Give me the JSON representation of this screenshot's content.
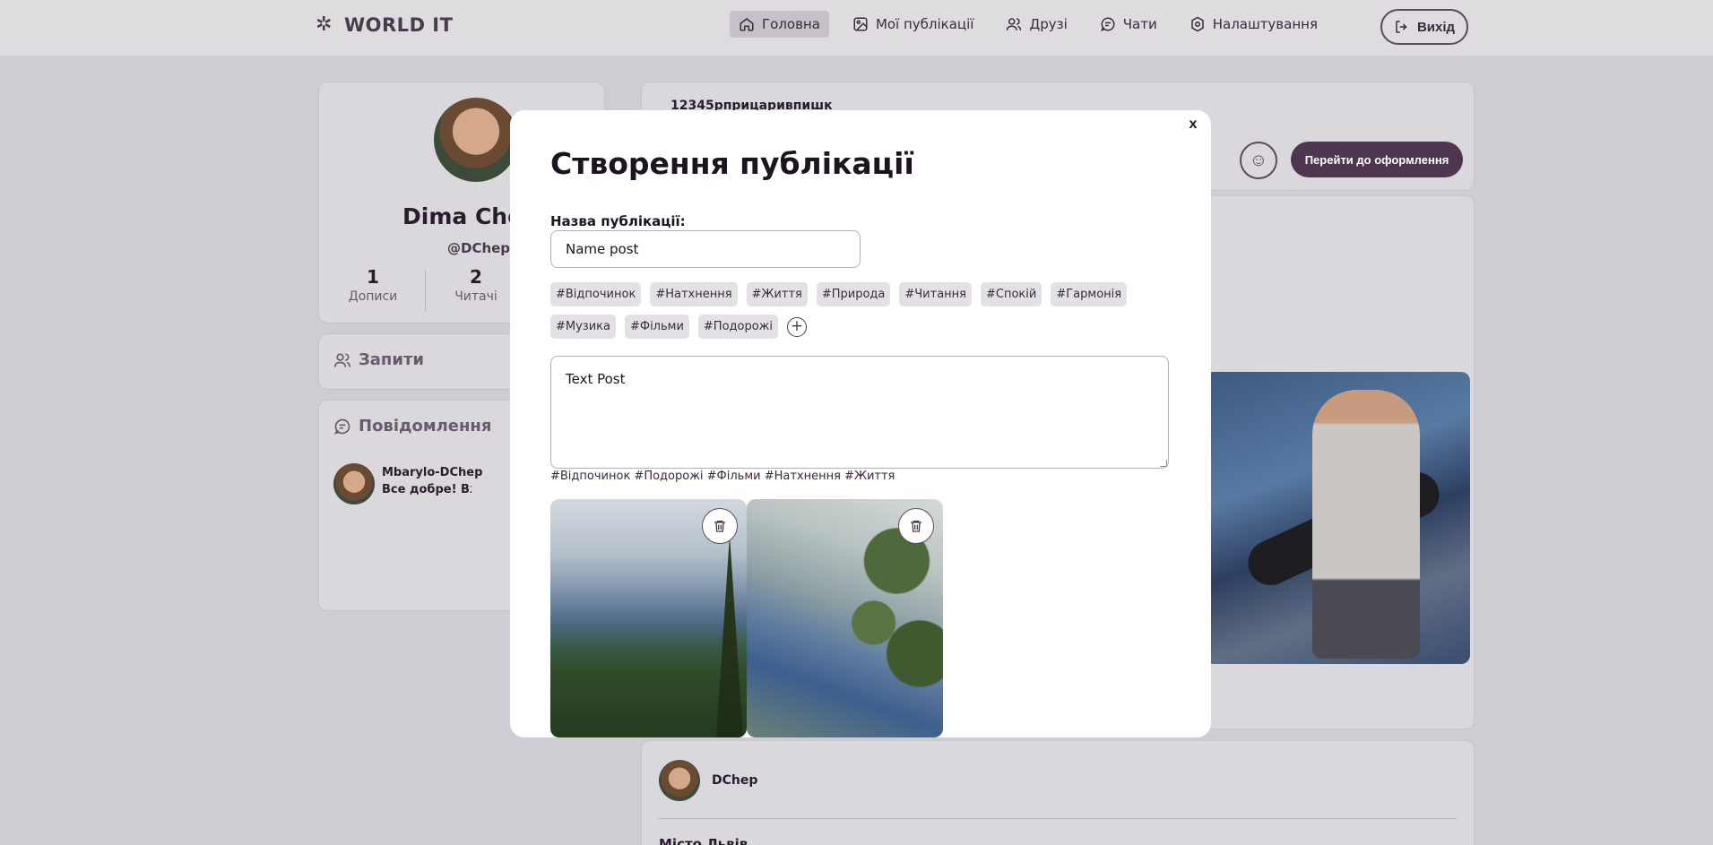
{
  "header": {
    "logo_text": "WORLD IT",
    "nav": [
      {
        "label": "Головна",
        "icon": "home-icon",
        "active": true
      },
      {
        "label": "Мої публікації",
        "icon": "image-icon",
        "active": false
      },
      {
        "label": "Друзі",
        "icon": "users-icon",
        "active": false
      },
      {
        "label": "Чати",
        "icon": "chat-icon",
        "active": false
      },
      {
        "label": "Налаштування",
        "icon": "gear-icon",
        "active": false
      }
    ],
    "logout_label": "Вихід"
  },
  "profile": {
    "name": "Dima Chep",
    "nick": "@DChep",
    "posts_count": "1",
    "posts_label": "Дописи",
    "readers_count": "2",
    "readers_label": "Читачі"
  },
  "sidebar": {
    "requests_title": "Запити",
    "messages_title": "Повідомлення",
    "message": {
      "name": "Mbarylo-DChep",
      "text": "Все добре! Вже вилікувався"
    }
  },
  "main": {
    "top_text": "12345рприцаривпишк",
    "design_button": "Перейти до оформлення",
    "post2_name": "DChep",
    "post2_title": "Мiсто Львiв"
  },
  "modal": {
    "title": "Створення публікації",
    "name_label": "Назва публікації:",
    "name_value": "Name post",
    "tags": [
      "#Відпочинок",
      "#Натхнення",
      "#Життя",
      "#Природа",
      "#Читання",
      "#Спокій",
      "#Гармонія",
      "#Музика",
      "#Фільми",
      "#Подорожі"
    ],
    "text_value": "Text Post",
    "selected_tags": "#Відпочинок #Подорожі #Фільми #Натхнення #Життя",
    "close_label": "x"
  },
  "colors": {
    "accent": "#4e3550",
    "background": "#cfcdd3",
    "modal_bg": "#ffffff"
  }
}
